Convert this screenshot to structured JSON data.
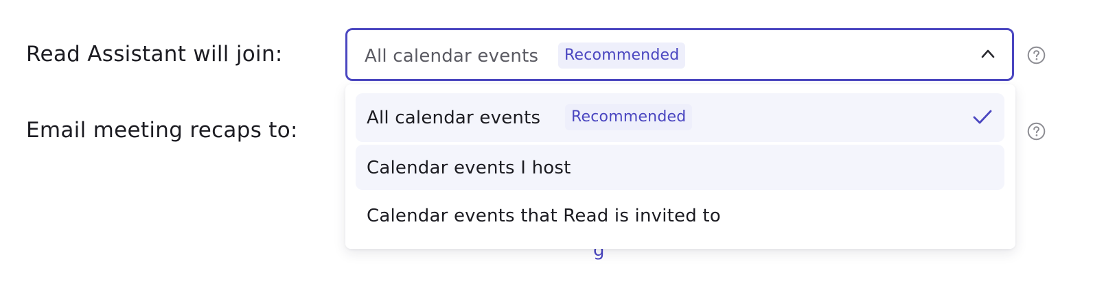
{
  "settings": {
    "join": {
      "label": "Read Assistant will join:",
      "selected_value": "All calendar events",
      "selected_badge": "Recommended"
    },
    "recaps": {
      "label": "Email meeting recaps to:"
    }
  },
  "dropdown": {
    "options": [
      {
        "label": "All calendar events",
        "badge": "Recommended",
        "selected": true
      },
      {
        "label": "Calendar events I host"
      },
      {
        "label": "Calendar events that Read is invited to"
      }
    ]
  },
  "obscured_link_fragment": "g",
  "icons": {
    "help": "question-circle-icon",
    "chevron": "chevron-up-icon",
    "check": "checkmark-icon"
  },
  "colors": {
    "accent": "#4a46c0",
    "badge_bg": "#eeeffb",
    "option_hover_bg": "#f4f5fc",
    "text": "#1c1c22",
    "muted_text": "#5a5a62"
  }
}
